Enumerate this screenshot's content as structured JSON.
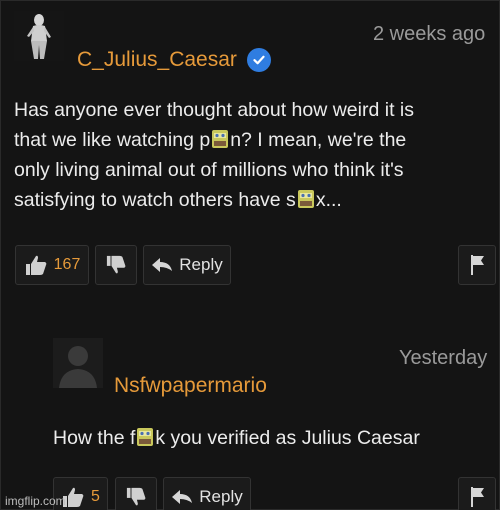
{
  "comment": {
    "username": "C_Julius_Caesar",
    "timestamp": "2 weeks ago",
    "lines": [
      "Has anyone ever thought about how weird it is",
      [
        "that we like watching p",
        "n? I mean, we're the"
      ],
      "only living animal out of millions who think it's",
      [
        "satisfying to watch others have s",
        "x..."
      ]
    ],
    "likes": "167",
    "reply_label": "Reply",
    "colors": {
      "username": "#e69a3a",
      "verified": "#2f7de1"
    }
  },
  "reply": {
    "username": "Nsfwpapermario",
    "timestamp": "Yesterday",
    "text": [
      "How the f",
      "k you verified as Julius Caesar"
    ],
    "likes": "5",
    "reply_label": "Reply"
  },
  "icons": [
    "thumbs-up-icon",
    "thumbs-down-icon",
    "reply-arrow-icon",
    "flag-icon",
    "verified-check-icon",
    "censor-sticker-icon"
  ],
  "watermark": "imgflip.com"
}
